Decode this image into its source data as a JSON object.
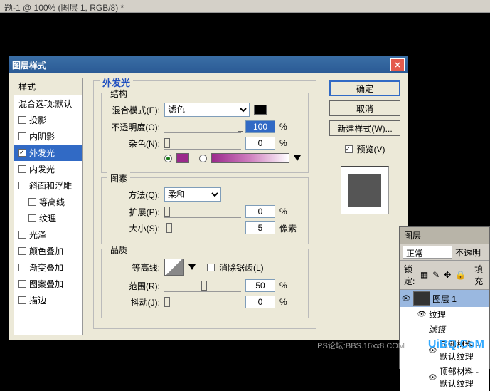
{
  "topbar": "题-1 @ 100% (图层 1, RGB/8) *",
  "dialog": {
    "title": "图层样式",
    "styles_header": "样式",
    "blend_opts": "混合选项:默认",
    "items": [
      {
        "label": "投影",
        "checked": false,
        "sel": false
      },
      {
        "label": "内阴影",
        "checked": false,
        "sel": false
      },
      {
        "label": "外发光",
        "checked": true,
        "sel": true
      },
      {
        "label": "内发光",
        "checked": false,
        "sel": false
      },
      {
        "label": "斜面和浮雕",
        "checked": false,
        "sel": false
      },
      {
        "label": "等高线",
        "checked": false,
        "sel": false,
        "indent": true
      },
      {
        "label": "纹理",
        "checked": false,
        "sel": false,
        "indent": true
      },
      {
        "label": "光泽",
        "checked": false,
        "sel": false
      },
      {
        "label": "颜色叠加",
        "checked": false,
        "sel": false
      },
      {
        "label": "渐变叠加",
        "checked": false,
        "sel": false
      },
      {
        "label": "图案叠加",
        "checked": false,
        "sel": false
      },
      {
        "label": "描边",
        "checked": false,
        "sel": false
      }
    ],
    "section_title": "外发光",
    "groups": {
      "structure": {
        "title": "结构",
        "blend_label": "混合模式(E):",
        "blend_value": "滤色",
        "opacity_label": "不透明度(O):",
        "opacity_value": "100",
        "opacity_unit": "%",
        "noise_label": "杂色(N):",
        "noise_value": "0",
        "noise_unit": "%",
        "color": "#9b2a8c"
      },
      "elements": {
        "title": "图素",
        "method_label": "方法(Q):",
        "method_value": "柔和",
        "spread_label": "扩展(P):",
        "spread_value": "0",
        "spread_unit": "%",
        "size_label": "大小(S):",
        "size_value": "5",
        "size_unit": "像素"
      },
      "quality": {
        "title": "品质",
        "contour_label": "等高线:",
        "aa_label": "消除锯齿(L)",
        "range_label": "范围(R):",
        "range_value": "50",
        "range_unit": "%",
        "jitter_label": "抖动(J):",
        "jitter_value": "0",
        "jitter_unit": "%"
      }
    },
    "buttons": {
      "ok": "确定",
      "cancel": "取消",
      "new_style": "新建样式(W)...",
      "preview": "预览(V)"
    }
  },
  "layers": {
    "tab": "图层",
    "blend": "正常",
    "opacity_label": "不透明",
    "lock": "锁定:",
    "fill_label": "填充",
    "layer1": "图层 1",
    "fx": "纹理",
    "fx2": "滤镜",
    "sub1": "底部材料 - 默认纹理",
    "sub2": "顶部材料 - 默认纹理"
  },
  "watermark": "UiBQ.CoM",
  "watermark2": "PS论坛:BBS.16xx8.COM"
}
